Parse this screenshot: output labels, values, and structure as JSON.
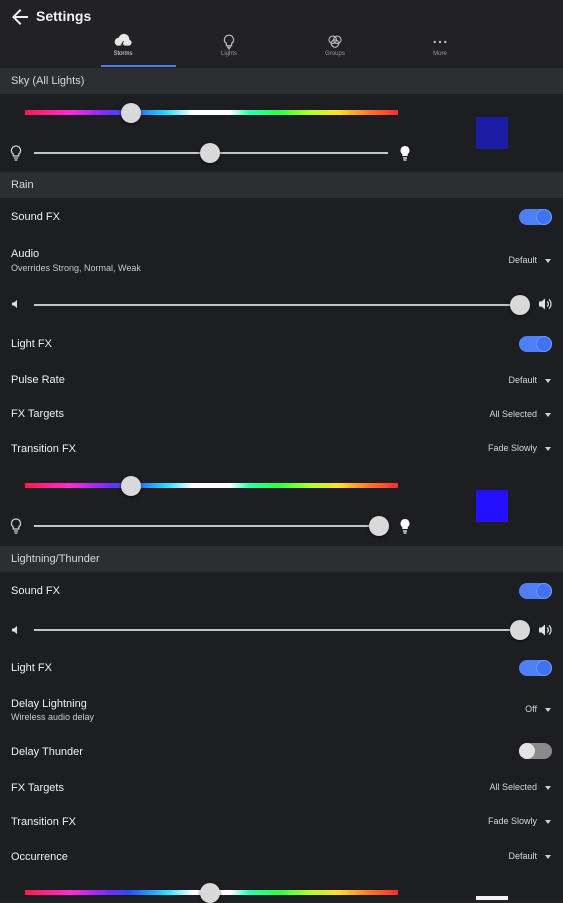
{
  "header": {
    "title": "Settings"
  },
  "tabs": [
    {
      "label": "Storms",
      "icon": "storm-cloud-icon"
    },
    {
      "label": "Lights",
      "icon": "bulb-icon"
    },
    {
      "label": "Groups",
      "icon": "groups-icon"
    },
    {
      "label": "More",
      "icon": "more-dots-icon"
    }
  ],
  "sky": {
    "title": "Sky (All Lights)",
    "hue_position": 0.28,
    "brightness": 0.5,
    "swatch_color": "#1c1ca6"
  },
  "rain": {
    "title": "Rain",
    "sound_fx": {
      "label": "Sound FX",
      "on": true
    },
    "audio": {
      "label": "Audio",
      "sublabel": "Overrides Strong, Normal, Weak",
      "value": "Default"
    },
    "volume": 1.0,
    "light_fx": {
      "label": "Light FX",
      "on": true
    },
    "pulse_rate": {
      "label": "Pulse Rate",
      "value": "Default"
    },
    "fx_targets": {
      "label": "FX Targets",
      "value": "All Selected"
    },
    "transition_fx": {
      "label": "Transition FX",
      "value": "Fade Slowly"
    },
    "hue_position": 0.28,
    "brightness": 0.97,
    "swatch_color": "#2410ff"
  },
  "lightning": {
    "title": "Lightning/Thunder",
    "sound_fx": {
      "label": "Sound FX",
      "on": true
    },
    "volume": 1.0,
    "light_fx": {
      "label": "Light FX",
      "on": true
    },
    "delay_lightning": {
      "label": "Delay Lightning",
      "sublabel": "Wireless audio delay",
      "value": "Off"
    },
    "delay_thunder": {
      "label": "Delay Thunder",
      "on": false
    },
    "fx_targets": {
      "label": "FX Targets",
      "value": "All Selected"
    },
    "transition_fx": {
      "label": "Transition FX",
      "value": "Fade Slowly"
    },
    "occurrence": {
      "label": "Occurrence",
      "value": "Default"
    },
    "hue_position": 0.5
  },
  "colors": {
    "accent": "#4f7ff4",
    "background": "#222225",
    "panel": "#1d1e21",
    "section": "#2d2e32"
  }
}
